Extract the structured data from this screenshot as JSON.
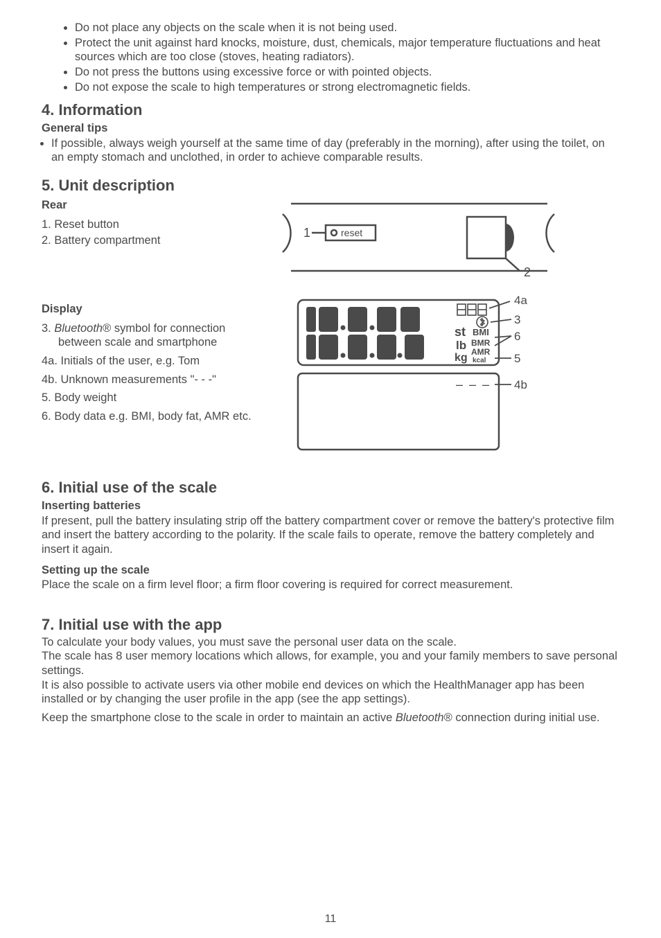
{
  "top_bullets": [
    "Do not place any objects on the scale when it is not being used.",
    "Protect the unit against hard knocks, moisture, dust, chemicals, major temperature fluctuations and heat sources which are too close (stoves, heating radiators).",
    "Do not press the buttons using excessive force or with pointed objects.",
    "Do not expose the scale to high temperatures or strong electromagnetic fields."
  ],
  "s4": {
    "title": "4. Information",
    "general_tips_label": "General tips",
    "general_tip": "If possible, always weigh yourself at the same time of day (preferably in the morning), after using the toilet, on an empty stomach and unclothed, in order to achieve comparable results."
  },
  "s5": {
    "title": "5. Unit description",
    "rear_label": "Rear",
    "rear_items": {
      "i1": "1. Reset button",
      "i2": "2. Battery compartment"
    },
    "rear_diag": {
      "num1": "1",
      "reset": "reset",
      "num2": "2"
    },
    "display_label": "Display",
    "display_items": {
      "i3a": "3. ",
      "i3b": "Bluetooth",
      "i3c": "® symbol for connection",
      "i3d": "between scale and smartphone",
      "i4a": "4a. Initials of the user,  e.g. Tom",
      "i4b": "4b. Unknown measurements \"- - -\"",
      "i5": "5. Body weight",
      "i6": "6. Body data e.g. BMI, body fat, AMR etc."
    },
    "disp_diag": {
      "st": "st",
      "lb": "lb",
      "kg": "kg",
      "bmi": "BMI",
      "bmr": "BMR",
      "amr": "AMR",
      "kcal": "kcal",
      "n4a": "4a",
      "n3": "3",
      "n6": "6",
      "n5": "5",
      "n4b": "4b",
      "dashes": "– – –"
    }
  },
  "s6": {
    "title": "6. Initial use of the scale",
    "ins_label": "Inserting batteries",
    "ins_text": "If present, pull the battery insulating strip off the battery compartment cover or remove the battery's protective film and insert the battery according to the polarity. If the scale fails to operate, remove the battery completely and insert it again.",
    "setup_label": "Setting up the scale",
    "setup_text": "Place the scale on a firm level floor; a firm floor covering is required for correct measurement."
  },
  "s7": {
    "title": "7. Initial use with the app",
    "p1": "To calculate your body values, you must save the personal user data on the scale.",
    "p2": "The scale has 8 user memory locations which allows, for example, you and your family members to save personal settings.",
    "p3": "It is also possible to activate users via other mobile end devices on which the HealthManager app has been installed or by changing the user profile in the app (see the app settings).",
    "p4a": "Keep the smartphone close to the scale in order to maintain an active ",
    "p4b": "Bluetooth",
    "p4c": "® connection during initial use."
  },
  "page_number": "11"
}
